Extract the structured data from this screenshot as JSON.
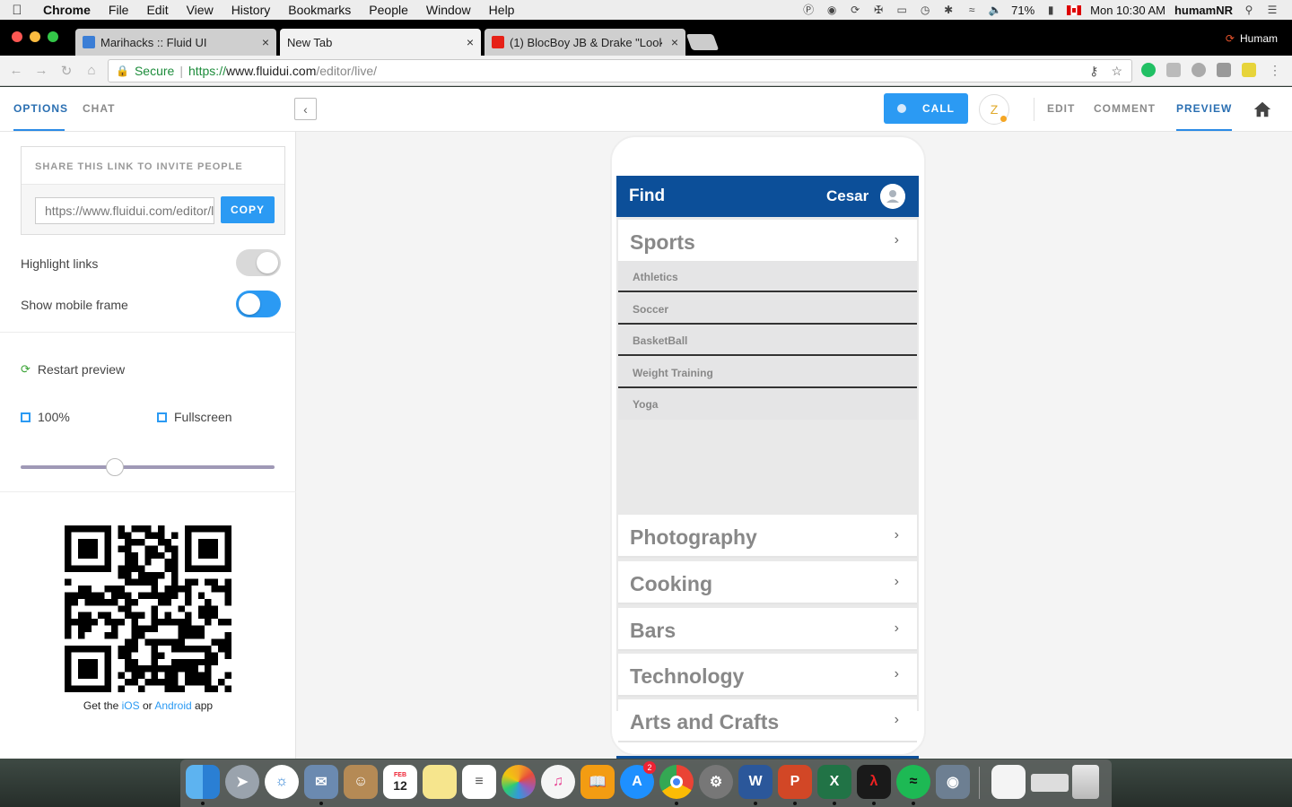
{
  "menubar": {
    "app": "Chrome",
    "items": [
      "File",
      "Edit",
      "View",
      "History",
      "Bookmarks",
      "People",
      "Window",
      "Help"
    ],
    "battery": "71%",
    "clock": "Mon 10:30 AM",
    "user": "humamNR"
  },
  "browser": {
    "tabs": [
      {
        "title": "Marihacks :: Fluid UI",
        "close": "×"
      },
      {
        "title": "New Tab",
        "close": "×"
      },
      {
        "title": "(1) BlocBoy JB & Drake \"Look",
        "close": "×"
      }
    ],
    "profile": "Humam",
    "address": {
      "secure_label": "Secure",
      "scheme": "https://",
      "host": "www.fluidui.com",
      "path": "/editor/live/"
    }
  },
  "app": {
    "left_tabs": [
      "OPTIONS",
      "CHAT"
    ],
    "call_label": "CALL",
    "avatar_initial": "Z",
    "right_tabs": [
      "EDIT",
      "COMMENT",
      "PREVIEW"
    ],
    "active_right_tab": "PREVIEW"
  },
  "options": {
    "share_heading": "SHARE THIS LINK TO INVITE PEOPLE",
    "share_url": "https://www.fluidui.com/editor/live/",
    "copy_label": "COPY",
    "highlight_links_label": "Highlight links",
    "highlight_links_on": false,
    "show_mobile_frame_label": "Show mobile frame",
    "show_mobile_frame_on": true,
    "restart_label": "Restart preview",
    "zoom_label": "100%",
    "fullscreen_label": "Fullscreen",
    "zoom_slider_value": 0.37,
    "get_app_prefix": "Get the",
    "ios_label": "iOS",
    "or_label": "or",
    "android_label": "Android",
    "get_app_suffix": "app"
  },
  "mobile": {
    "title": "Find",
    "user_name": "Cesar",
    "expanded_category": "Sports",
    "subcategories": [
      "Athletics",
      "Soccer",
      "BasketBall",
      "Weight Training",
      "Yoga"
    ],
    "categories": [
      "Photography",
      "Cooking",
      "Bars",
      "Technology",
      "Arts and Crafts"
    ],
    "chevron": "›",
    "tabbar_icons": [
      "map-icon",
      "search-icon",
      "trending-icon",
      "settings-icon"
    ]
  },
  "dock": {
    "calendar_month": "FEB",
    "calendar_day": "12",
    "appstore_badge": "2"
  },
  "colors": {
    "accent": "#2b9af3",
    "mobile_header": "#0c4f99",
    "secure_green": "#1d8c3b"
  }
}
